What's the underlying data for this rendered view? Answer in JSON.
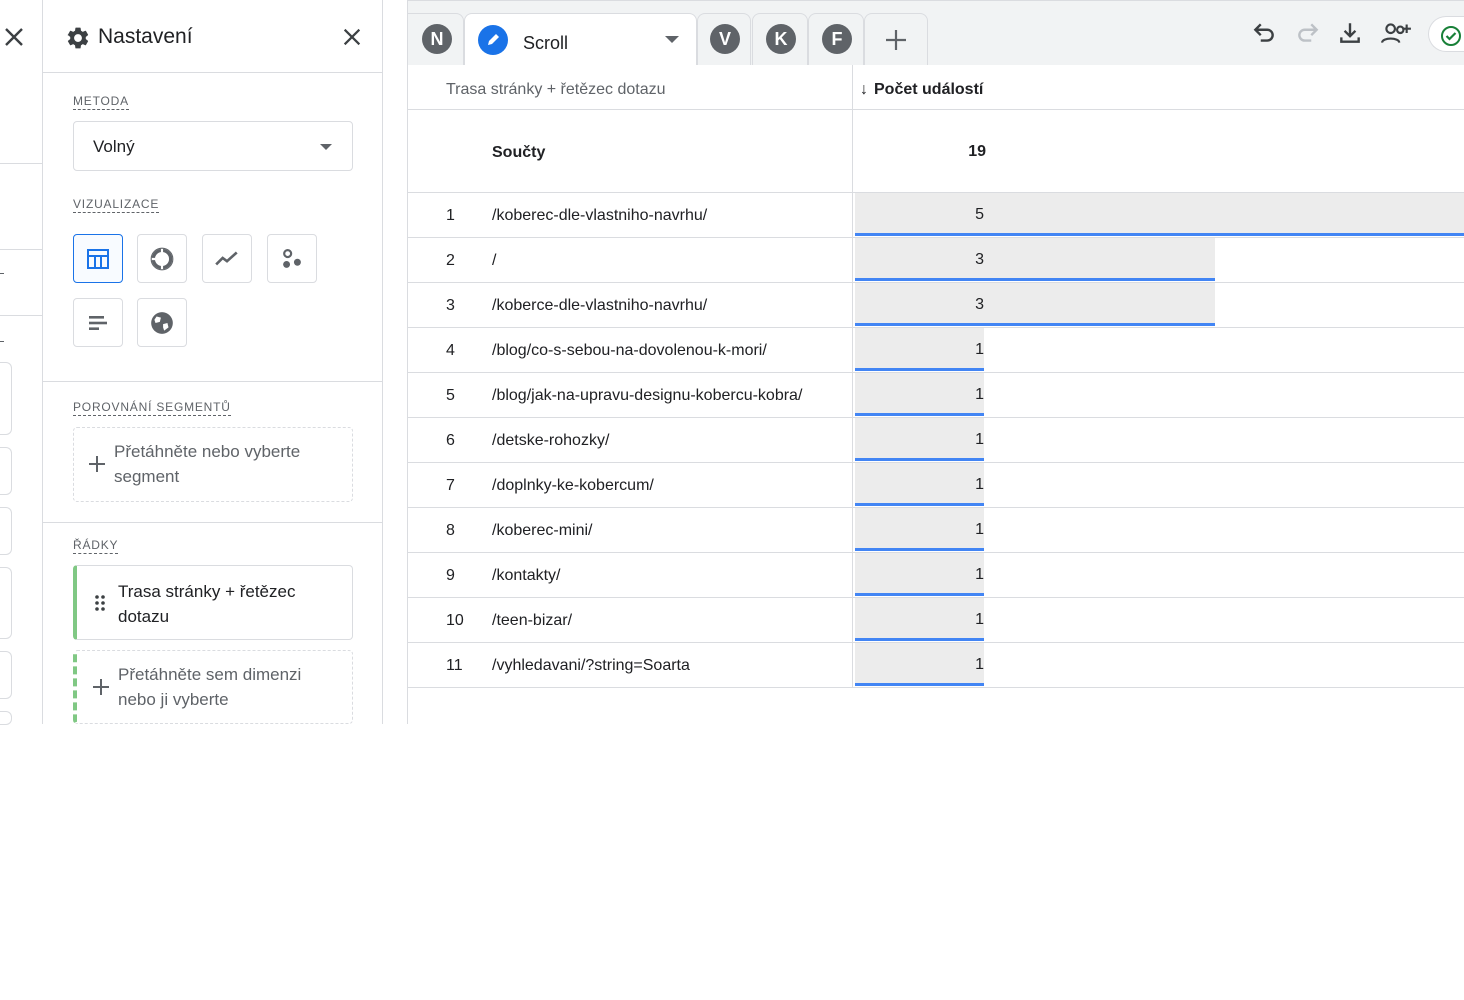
{
  "settings": {
    "title": "Nastavení",
    "method": {
      "label": "METODA",
      "value": "Volný"
    },
    "visualization": {
      "label": "VIZUALIZACE",
      "options": [
        "table-icon",
        "donut-chart-icon",
        "line-chart-icon",
        "scatter-icon",
        "bar-chart-icon",
        "geo-map-icon"
      ],
      "selected": "table-icon"
    },
    "segments": {
      "label": "POROVNÁNÍ SEGMENTŮ",
      "drop_text": "Přetáhněte nebo vyberte segment"
    },
    "rows": {
      "label": "ŘÁDKY",
      "dimension": "Trasa stránky + řetězec dotazu",
      "drop_text": "Přetáhněte sem dimenzi nebo ji vyberte"
    }
  },
  "tabs": {
    "avatars": [
      "N",
      "V",
      "K",
      "F"
    ],
    "active_label": "Scroll"
  },
  "toolbar": {
    "icons": [
      "undo-icon",
      "redo-icon",
      "download-icon",
      "share-user-icon",
      "status-check-icon"
    ]
  },
  "table": {
    "dimension_header": "Trasa stránky + řetězec dotazu",
    "metric_header": "Počet událostí",
    "totals_label": "Součty",
    "totals_value": "19",
    "max_value": 5,
    "rows": [
      {
        "idx": "1",
        "path": "/koberec-dle-vlastniho-navrhu/",
        "value": "5"
      },
      {
        "idx": "2",
        "path": "/",
        "value": "3"
      },
      {
        "idx": "3",
        "path": "/koberce-dle-vlastniho-navrhu/",
        "value": "3"
      },
      {
        "idx": "4",
        "path": "/blog/co-s-sebou-na-dovolenou-k-mori/",
        "value": "1"
      },
      {
        "idx": "5",
        "path": "/blog/jak-na-upravu-designu-kobercu-kobra/",
        "value": "1"
      },
      {
        "idx": "6",
        "path": "/detske-rohozky/",
        "value": "1"
      },
      {
        "idx": "7",
        "path": "/doplnky-ke-kobercum/",
        "value": "1"
      },
      {
        "idx": "8",
        "path": "/koberec-mini/",
        "value": "1"
      },
      {
        "idx": "9",
        "path": "/kontakty/",
        "value": "1"
      },
      {
        "idx": "10",
        "path": "/teen-bizar/",
        "value": "1"
      },
      {
        "idx": "11",
        "path": "/vyhledavani/?string=Soarta",
        "value": "1"
      }
    ]
  },
  "colors": {
    "accent": "#1a73e8",
    "bar": "#ececec",
    "bar_line": "#4285f4",
    "dimension_chip": "#80c884"
  }
}
